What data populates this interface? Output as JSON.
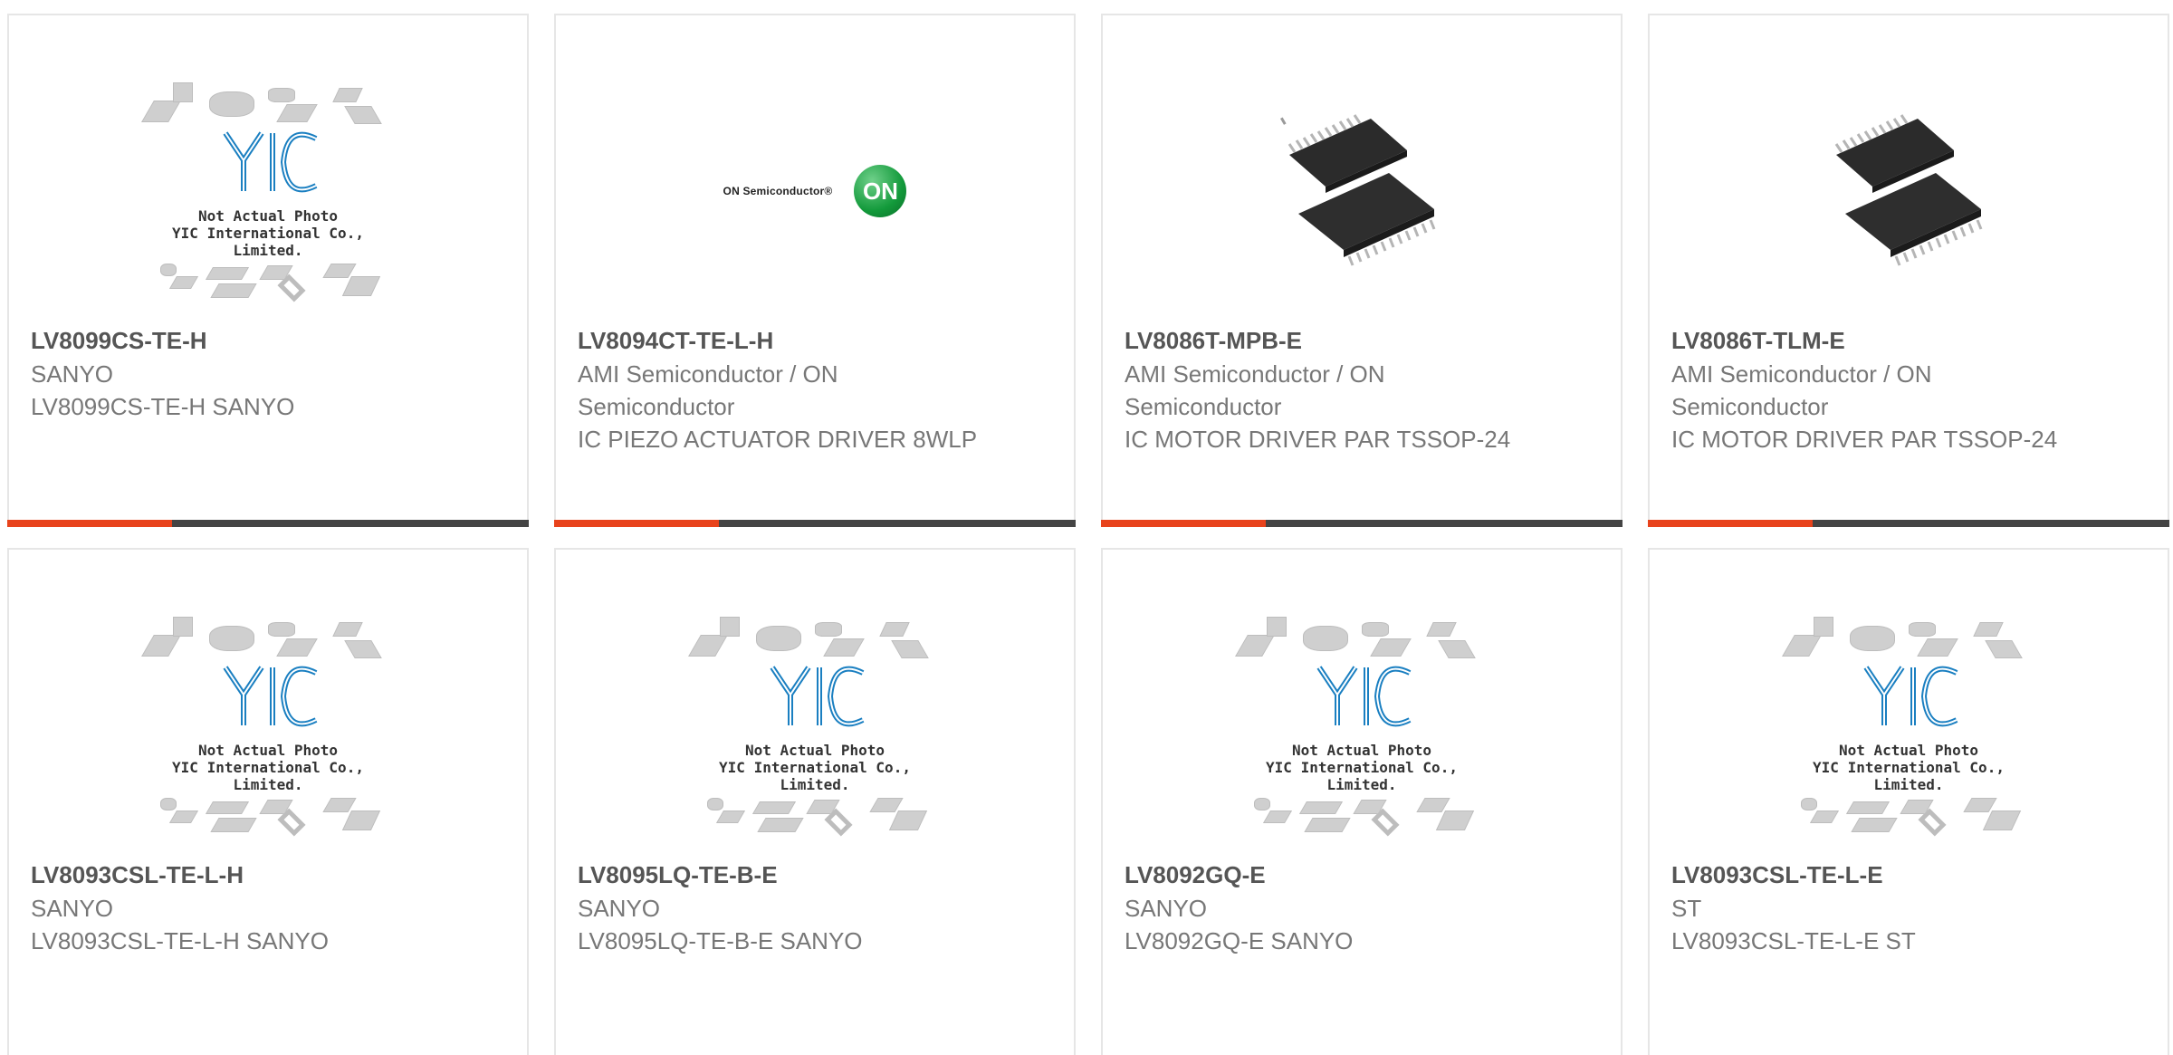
{
  "products": [
    {
      "part": "LV8099CS-TE-H",
      "brand": "SANYO",
      "description": "LV8099CS-TE-H SANYO",
      "image": "placeholder"
    },
    {
      "part": "LV8094CT-TE-L-H",
      "brand": "AMI Semiconductor / ON Semiconductor",
      "description": "IC PIEZO ACTUATOR DRIVER 8WLP",
      "image": "on-semiconductor-logo"
    },
    {
      "part": "LV8086T-MPB-E",
      "brand": "AMI Semiconductor / ON Semiconductor",
      "description": "IC MOTOR DRIVER PAR TSSOP-24",
      "image": "tssop-chip-photo"
    },
    {
      "part": "LV8086T-TLM-E",
      "brand": "AMI Semiconductor / ON Semiconductor",
      "description": "IC MOTOR DRIVER PAR TSSOP-24",
      "image": "tssop-chip-photo"
    },
    {
      "part": "LV8093CSL-TE-L-H",
      "brand": "SANYO",
      "description": "LV8093CSL-TE-L-H SANYO",
      "image": "placeholder"
    },
    {
      "part": "LV8095LQ-TE-B-E",
      "brand": "SANYO",
      "description": "LV8095LQ-TE-B-E SANYO",
      "image": "placeholder"
    },
    {
      "part": "LV8092GQ-E",
      "brand": "SANYO",
      "description": "LV8092GQ-E SANYO",
      "image": "placeholder"
    },
    {
      "part": "LV8093CSL-TE-L-E",
      "brand": "ST",
      "description": "LV8093CSL-TE-L-E ST",
      "image": "placeholder"
    }
  ],
  "placeholder": {
    "line1": "Not Actual Photo",
    "line2": "YIC International Co., Limited."
  },
  "on_logo": {
    "text": "ON Semiconductor®",
    "mark": "ON"
  },
  "colors": {
    "accent": "#e8431c",
    "bar": "#444444",
    "logo_blue": "#1a7fc1",
    "on_green": "#139a3b"
  }
}
